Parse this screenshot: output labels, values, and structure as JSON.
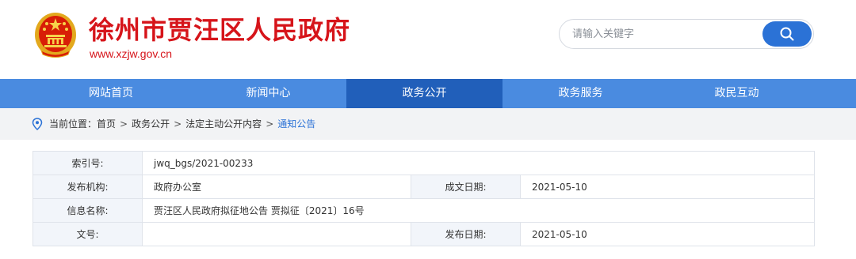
{
  "header": {
    "site_title": "徐州市贾汪区人民政府",
    "site_url": "www.xzjw.gov.cn",
    "emblem_icon": "national-emblem-icon",
    "brand_color": "#d6141a"
  },
  "search": {
    "placeholder": "请输入关键字",
    "button_icon": "search-icon",
    "accent": "#2b72d6"
  },
  "nav": {
    "items": [
      {
        "label": "网站首页"
      },
      {
        "label": "新闻中心"
      },
      {
        "label": "政务公开"
      },
      {
        "label": "政务服务"
      },
      {
        "label": "政民互动"
      }
    ],
    "active_label": "政务公开",
    "bar_color": "#4a8be0",
    "active_color": "#215fba"
  },
  "breadcrumb": {
    "prefix": "当前位置：",
    "items": [
      "首页",
      "政务公开",
      "法定主动公开内容",
      "通知公告"
    ],
    "separator": ">",
    "icon": "location-pin-icon"
  },
  "info": {
    "index_label": "索引号:",
    "index_value": "jwq_bgs/2021-00233",
    "publisher_label": "发布机构:",
    "publisher_value": "政府办公室",
    "created_label": "成文日期:",
    "created_value": "2021-05-10",
    "name_label": "信息名称:",
    "name_value": "贾汪区人民政府拟征地公告 贾拟征〔2021〕16号",
    "doc_label": "文号:",
    "doc_value": "",
    "published_label": "发布日期:",
    "published_value": "2021-05-10"
  }
}
